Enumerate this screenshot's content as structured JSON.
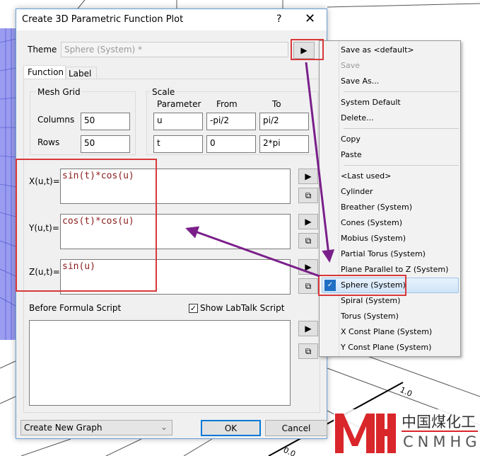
{
  "dialog": {
    "title": "Create 3D Parametric Function Plot",
    "help": "?",
    "close": "✕",
    "theme_label": "Theme",
    "theme_value": "Sphere (System) *",
    "tabs": [
      "Function",
      "Label"
    ],
    "mesh": {
      "title": "Mesh Grid",
      "columns_label": "Columns",
      "columns": "50",
      "rows_label": "Rows",
      "rows": "50"
    },
    "scale": {
      "title": "Scale",
      "headers": [
        "Parameter",
        "From",
        "To"
      ],
      "rows": [
        [
          "u",
          "-pi/2",
          "pi/2"
        ],
        [
          "t",
          "0",
          "2*pi"
        ]
      ]
    },
    "formulas": [
      {
        "label": "X(u,t)=",
        "value": "sin(t)*cos(u)"
      },
      {
        "label": "Y(u,t)=",
        "value": "cos(t)*cos(u)"
      },
      {
        "label": "Z(u,t)=",
        "value": "sin(u)"
      }
    ],
    "before_script_label": "Before Formula Script",
    "show_labtalk": "Show LabTalk Script",
    "show_labtalk_checked": true,
    "output_option": "Create New Graph",
    "ok": "OK",
    "cancel": "Cancel"
  },
  "menu": {
    "items": [
      "Save as <default>",
      "Save",
      "Save As...",
      "System Default",
      "Delete...",
      "Copy",
      "Paste",
      "<Last used>",
      "Cylinder",
      "Breather (System)",
      "Cones (System)",
      "Mobius (System)",
      "Partial Torus (System)",
      "Plane Parallel to Z (System)",
      "Sphere (System)",
      "Spiral (System)",
      "Torus (System)",
      "X Const Plane (System)",
      "Y Const Plane (System)"
    ],
    "selected": "Sphere (System)",
    "disabled": "Save"
  },
  "axis_ticks": [
    "1.0",
    "0.0"
  ],
  "watermark": {
    "cn": "中国煤化工",
    "en": "CNMHG"
  },
  "colors": {
    "highlight": "#d9383a",
    "arrow": "#7a1f8a",
    "accent": "#0078d7"
  }
}
